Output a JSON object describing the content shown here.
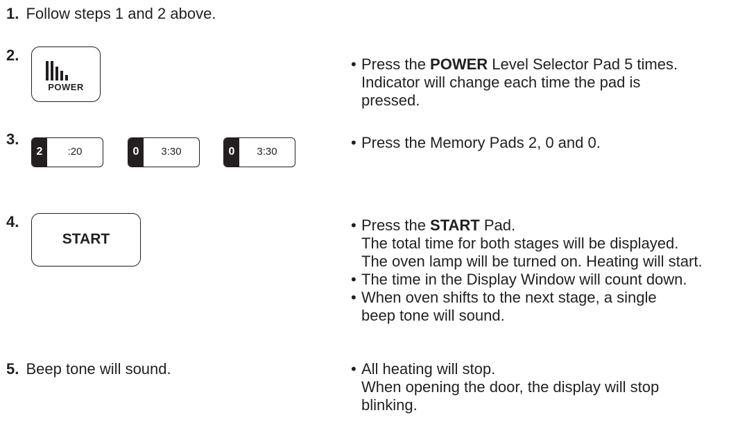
{
  "steps": [
    {
      "number": "1.",
      "text": "Follow steps 1 and 2 above."
    },
    {
      "number": "2.",
      "button_label": "POWER",
      "bullets": [
        {
          "prefix": "Press the ",
          "bold": "POWER",
          "suffix": " Level Selector Pad 5 times.",
          "continuation": [
            "Indicator will change each time the pad is",
            "pressed."
          ]
        }
      ]
    },
    {
      "number": "3.",
      "pads": [
        {
          "digit": "2",
          "time": ":20"
        },
        {
          "digit": "0",
          "time": "3:30"
        },
        {
          "digit": "0",
          "time": "3:30"
        }
      ],
      "bullets": [
        {
          "text": "Press the Memory Pads 2, 0 and 0."
        }
      ]
    },
    {
      "number": "4.",
      "button_label": "START",
      "bullets": [
        {
          "prefix": "Press the ",
          "bold": "START",
          "suffix": " Pad.",
          "continuation": [
            "The total time for both stages will be displayed.",
            "The oven lamp will be turned on. Heating will start."
          ]
        },
        {
          "text": "The time in the Display Window will count down."
        },
        {
          "text": "When oven shifts to the next stage, a single",
          "continuation": [
            "beep tone will sound."
          ]
        }
      ]
    },
    {
      "number": "5.",
      "text": "Beep tone will sound.",
      "bullets": [
        {
          "text": "All heating will stop.",
          "continuation": [
            "When opening the door, the display will stop",
            "blinking."
          ]
        }
      ]
    }
  ],
  "bullet_char": "•",
  "icons": {
    "power_bars": "power-level-bars-icon"
  }
}
